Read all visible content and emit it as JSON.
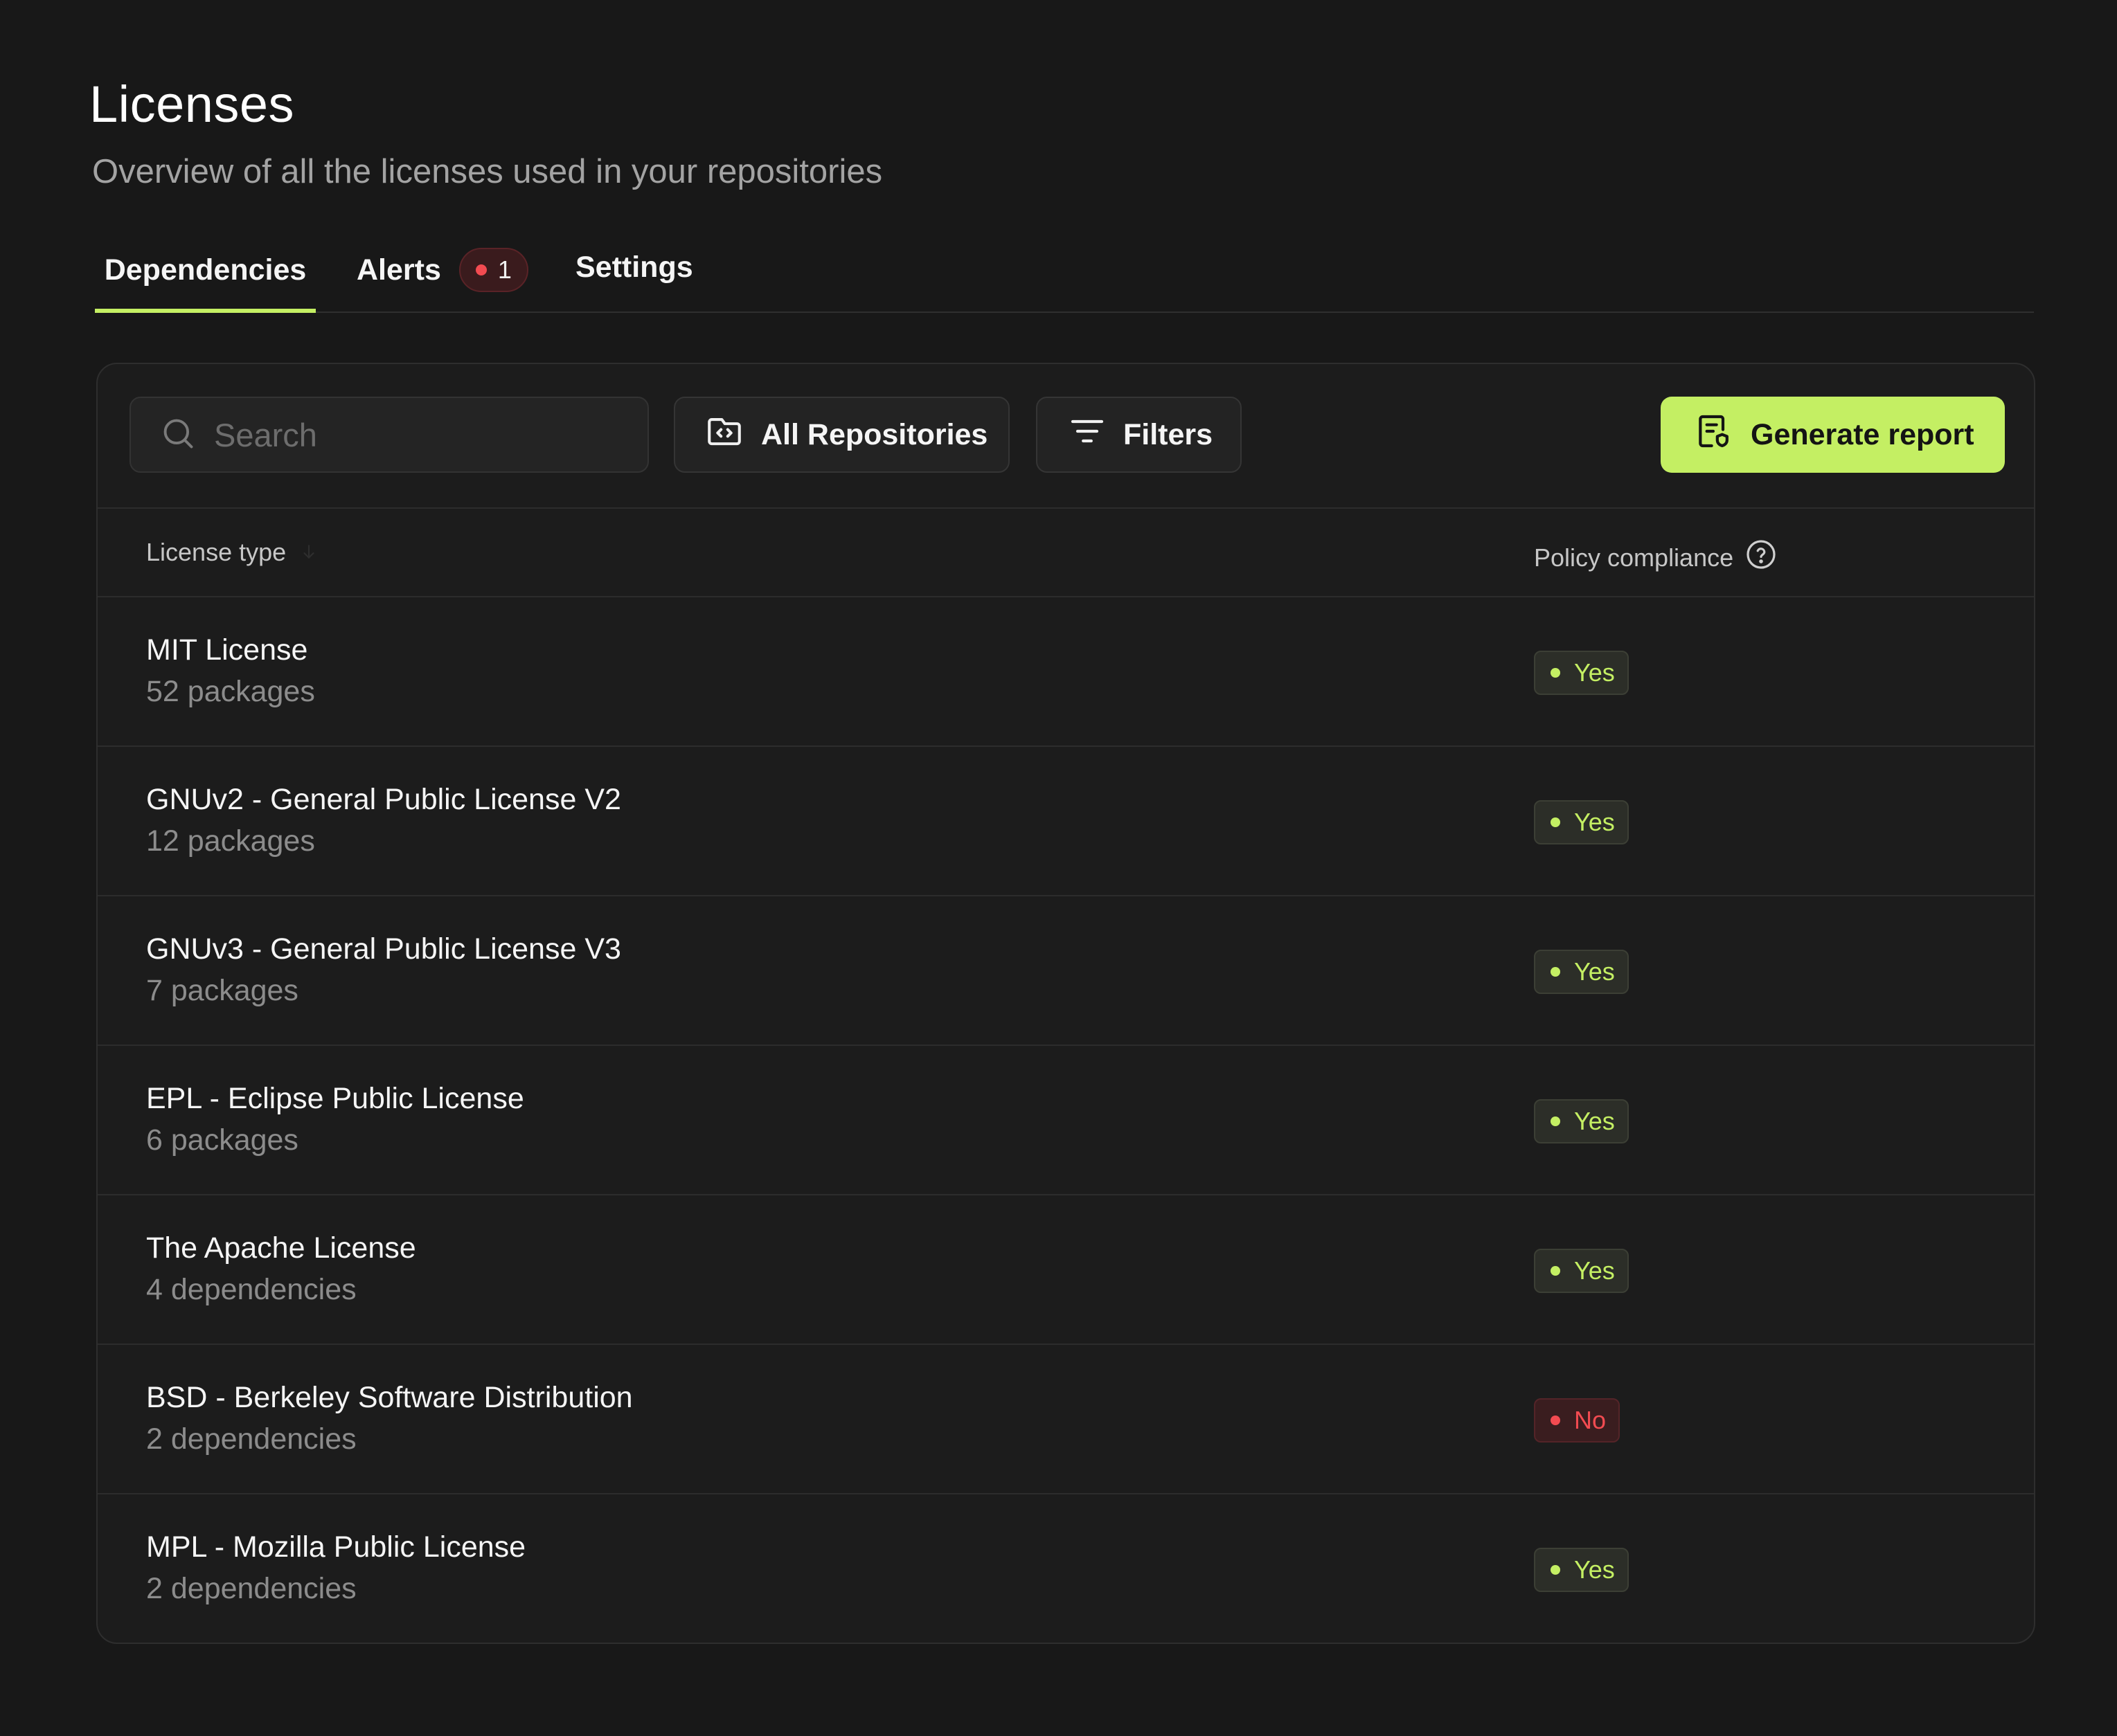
{
  "header": {
    "title": "Licenses",
    "subtitle": "Overview of all the licenses used in your repositories"
  },
  "tabs": [
    {
      "label": "Dependencies",
      "active": true
    },
    {
      "label": "Alerts",
      "badge": "1"
    },
    {
      "label": "Settings"
    }
  ],
  "toolbar": {
    "search_placeholder": "Search",
    "repos_label": "All Repositories",
    "filters_label": "Filters",
    "report_label": "Generate report"
  },
  "table": {
    "columns": [
      "License type",
      "Policy compliance"
    ],
    "rows": [
      {
        "name": "MIT License",
        "count": "52 packages",
        "compliance": "Yes"
      },
      {
        "name": "GNUv2 - General Public License V2",
        "count": "12 packages",
        "compliance": "Yes"
      },
      {
        "name": "GNUv3 - General Public License V3",
        "count": "7 packages",
        "compliance": "Yes"
      },
      {
        "name": "EPL - Eclipse Public License",
        "count": "6 packages",
        "compliance": "Yes"
      },
      {
        "name": "The Apache License",
        "count": "4 dependencies",
        "compliance": "Yes"
      },
      {
        "name": "BSD - Berkeley Software Distribution",
        "count": "2 dependencies",
        "compliance": "No"
      },
      {
        "name": "MPL - Mozilla Public License",
        "count": "2 dependencies",
        "compliance": "Yes"
      }
    ]
  },
  "colors": {
    "accent": "#c4ef63",
    "danger": "#f24b51",
    "background": "#181818"
  },
  "icons": [
    "search-icon",
    "folder-code-icon",
    "filter-icon",
    "report-icon",
    "sort-arrow-icon",
    "help-circle-icon"
  ]
}
